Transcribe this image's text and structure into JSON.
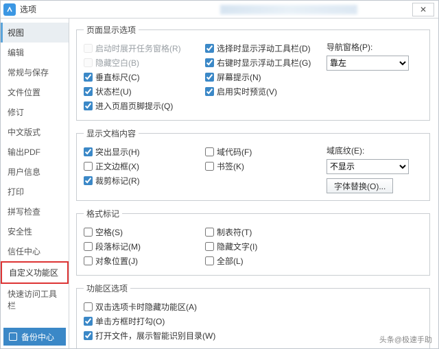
{
  "titlebar": {
    "title": "选项",
    "close": "✕"
  },
  "sidebar": {
    "items": [
      {
        "label": "视图"
      },
      {
        "label": "编辑"
      },
      {
        "label": "常规与保存"
      },
      {
        "label": "文件位置"
      },
      {
        "label": "修订"
      },
      {
        "label": "中文版式"
      },
      {
        "label": "输出PDF"
      },
      {
        "label": "用户信息"
      },
      {
        "label": "打印"
      },
      {
        "label": "拼写检查"
      },
      {
        "label": "安全性"
      },
      {
        "label": "信任中心"
      },
      {
        "label": "自定义功能区"
      },
      {
        "label": "快速访问工具栏"
      }
    ],
    "backup": "备份中心"
  },
  "groups": {
    "page_display": {
      "legend": "页面显示选项",
      "col1": [
        {
          "label": "启动时展开任务窗格(R)",
          "checked": false,
          "disabled": true
        },
        {
          "label": "隐藏空白(B)",
          "checked": false,
          "disabled": true
        },
        {
          "label": "垂直标尺(C)",
          "checked": true
        },
        {
          "label": "状态栏(U)",
          "checked": true
        },
        {
          "label": "进入页眉页脚提示(Q)",
          "checked": true
        }
      ],
      "col2": [
        {
          "label": "选择时显示浮动工具栏(D)",
          "checked": true
        },
        {
          "label": "右键时显示浮动工具栏(G)",
          "checked": true
        },
        {
          "label": "屏幕提示(N)",
          "checked": true
        },
        {
          "label": "启用实时预览(V)",
          "checked": true
        }
      ],
      "nav_label": "导航窗格(P):",
      "nav_value": "靠左"
    },
    "doc_content": {
      "legend": "显示文档内容",
      "col1": [
        {
          "label": "突出显示(H)",
          "checked": true
        },
        {
          "label": "正文边框(X)",
          "checked": false
        },
        {
          "label": "裁剪标记(R)",
          "checked": true
        }
      ],
      "col2": [
        {
          "label": "域代码(F)",
          "checked": false
        },
        {
          "label": "书签(K)",
          "checked": false
        }
      ],
      "shade_label": "域底纹(E):",
      "shade_value": "不显示",
      "font_btn": "字体替换(O)..."
    },
    "format_marks": {
      "legend": "格式标记",
      "col1": [
        {
          "label": "空格(S)",
          "checked": false
        },
        {
          "label": "段落标记(M)",
          "checked": false
        },
        {
          "label": "对象位置(J)",
          "checked": false
        }
      ],
      "col2": [
        {
          "label": "制表符(T)",
          "checked": false
        },
        {
          "label": "隐藏文字(I)",
          "checked": false
        },
        {
          "label": "全部(L)",
          "checked": false
        }
      ]
    },
    "ribbon": {
      "legend": "功能区选项",
      "items": [
        {
          "label": "双击选项卡时隐藏功能区(A)",
          "checked": false
        },
        {
          "label": "单击方框时打勾(O)",
          "checked": true
        },
        {
          "label": "打开文件，展示智能识别目录(W)",
          "checked": true
        }
      ]
    }
  },
  "watermark": "头条@极速手助"
}
